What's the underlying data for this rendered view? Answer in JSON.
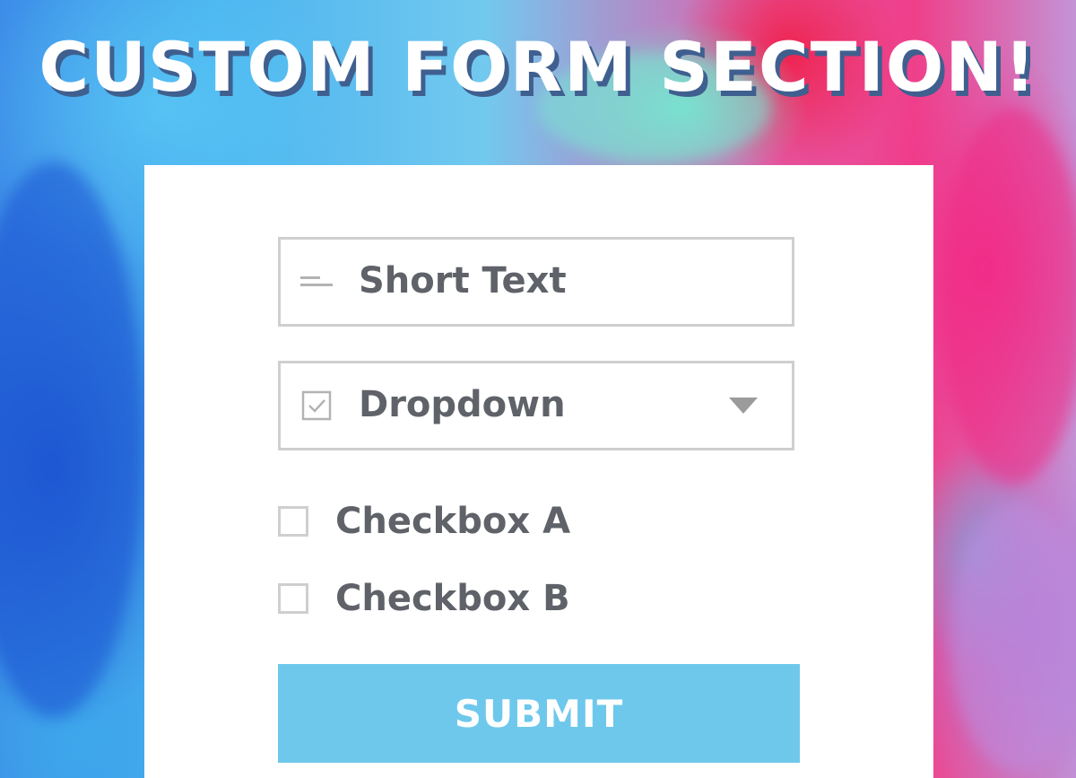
{
  "colors": {
    "title_text": "#ffffff",
    "title_shadow": "#3f5f8f",
    "card_background": "#ffffff",
    "field_border": "#cfcfcf",
    "label_text": "#5f6268",
    "caret": "#9b9b9b",
    "submit_background": "#6ec8ec",
    "submit_text": "#ffffff"
  },
  "header": {
    "title": "CUSTOM FORM SECTION!"
  },
  "form": {
    "short_text": {
      "icon": "short-text-icon",
      "label": "Short Text"
    },
    "dropdown": {
      "icon": "checkbox-checked-icon",
      "label": "Dropdown",
      "caret_icon": "chevron-down-icon"
    },
    "checkboxes": [
      {
        "label": "Checkbox A",
        "checked": false
      },
      {
        "label": "Checkbox B",
        "checked": false
      }
    ],
    "submit_label": "SUBMIT"
  }
}
